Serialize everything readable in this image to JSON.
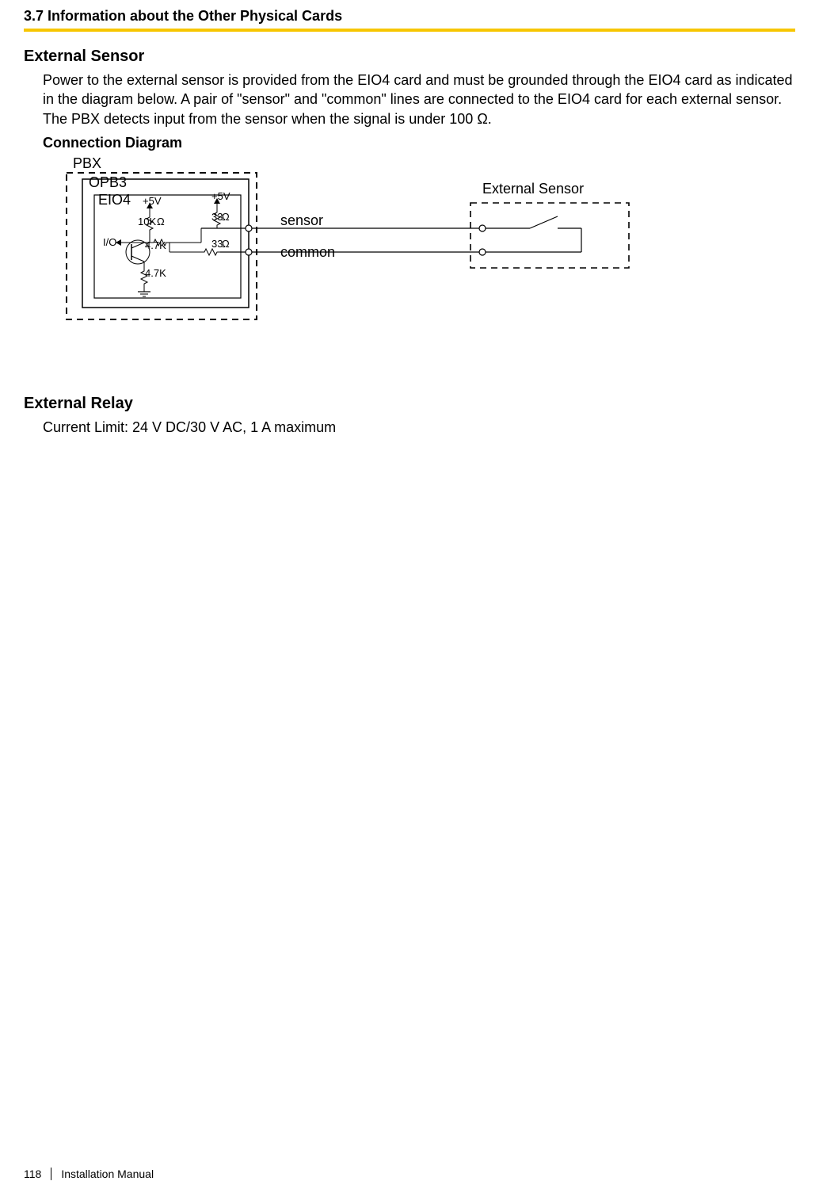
{
  "header": {
    "section": "3.7 Information about the Other Physical Cards"
  },
  "sensor": {
    "title": "External Sensor",
    "paragraph": "Power to the external sensor is provided from the EIO4 card and must be grounded through the EIO4 card as indicated in the diagram below. A pair of \"sensor\" and \"common\" lines are connected to the EIO4 card for each external sensor. The PBX detects input from the sensor when the signal is under 100 Ω.",
    "diagram_title": "Connection Diagram",
    "labels": {
      "pbx": "PBX",
      "opb3": "OPB3",
      "eio4": "EIO4",
      "v5_a": "+5V",
      "v5_b": "+5V",
      "r10k": "10K",
      "r47k_a": "4.7K",
      "r47k_b": "4.7K",
      "r33_a": "33",
      "r33_b": "33",
      "io": "I/O",
      "ohm1": "Ω",
      "ohm2": "Ω",
      "ohm3": "Ω",
      "sensor_line": "sensor",
      "common_line": "common",
      "ext_sensor": "External Sensor"
    }
  },
  "relay": {
    "title": "External Relay",
    "text": "Current Limit: 24 V DC/30 V AC, 1 A maximum"
  },
  "footer": {
    "page": "118",
    "doc": "Installation Manual"
  }
}
